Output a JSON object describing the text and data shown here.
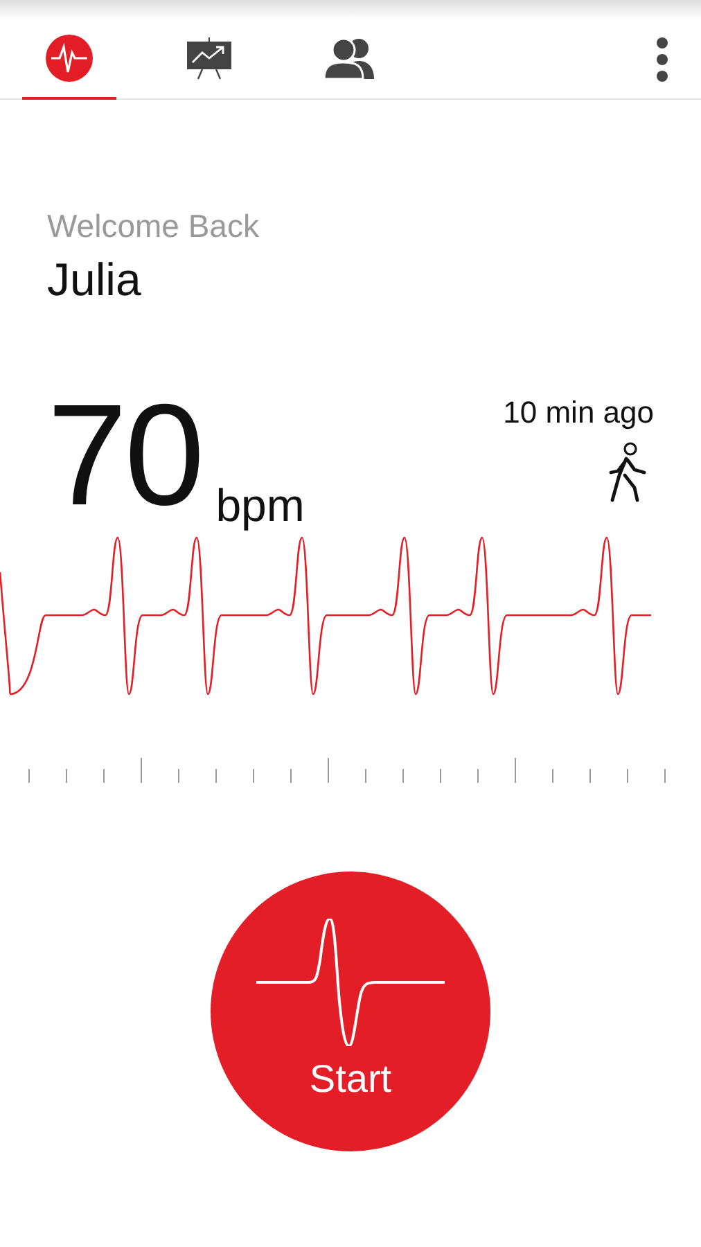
{
  "tabs": [
    {
      "kind": "heart-rate",
      "selected": true
    },
    {
      "kind": "chart",
      "selected": false
    },
    {
      "kind": "people",
      "selected": false
    }
  ],
  "greeting": "Welcome Back",
  "user_name": "Julia",
  "reading": {
    "value": "70",
    "unit": "bpm",
    "time": "10 min ago"
  },
  "start_button": {
    "label": "Start"
  }
}
